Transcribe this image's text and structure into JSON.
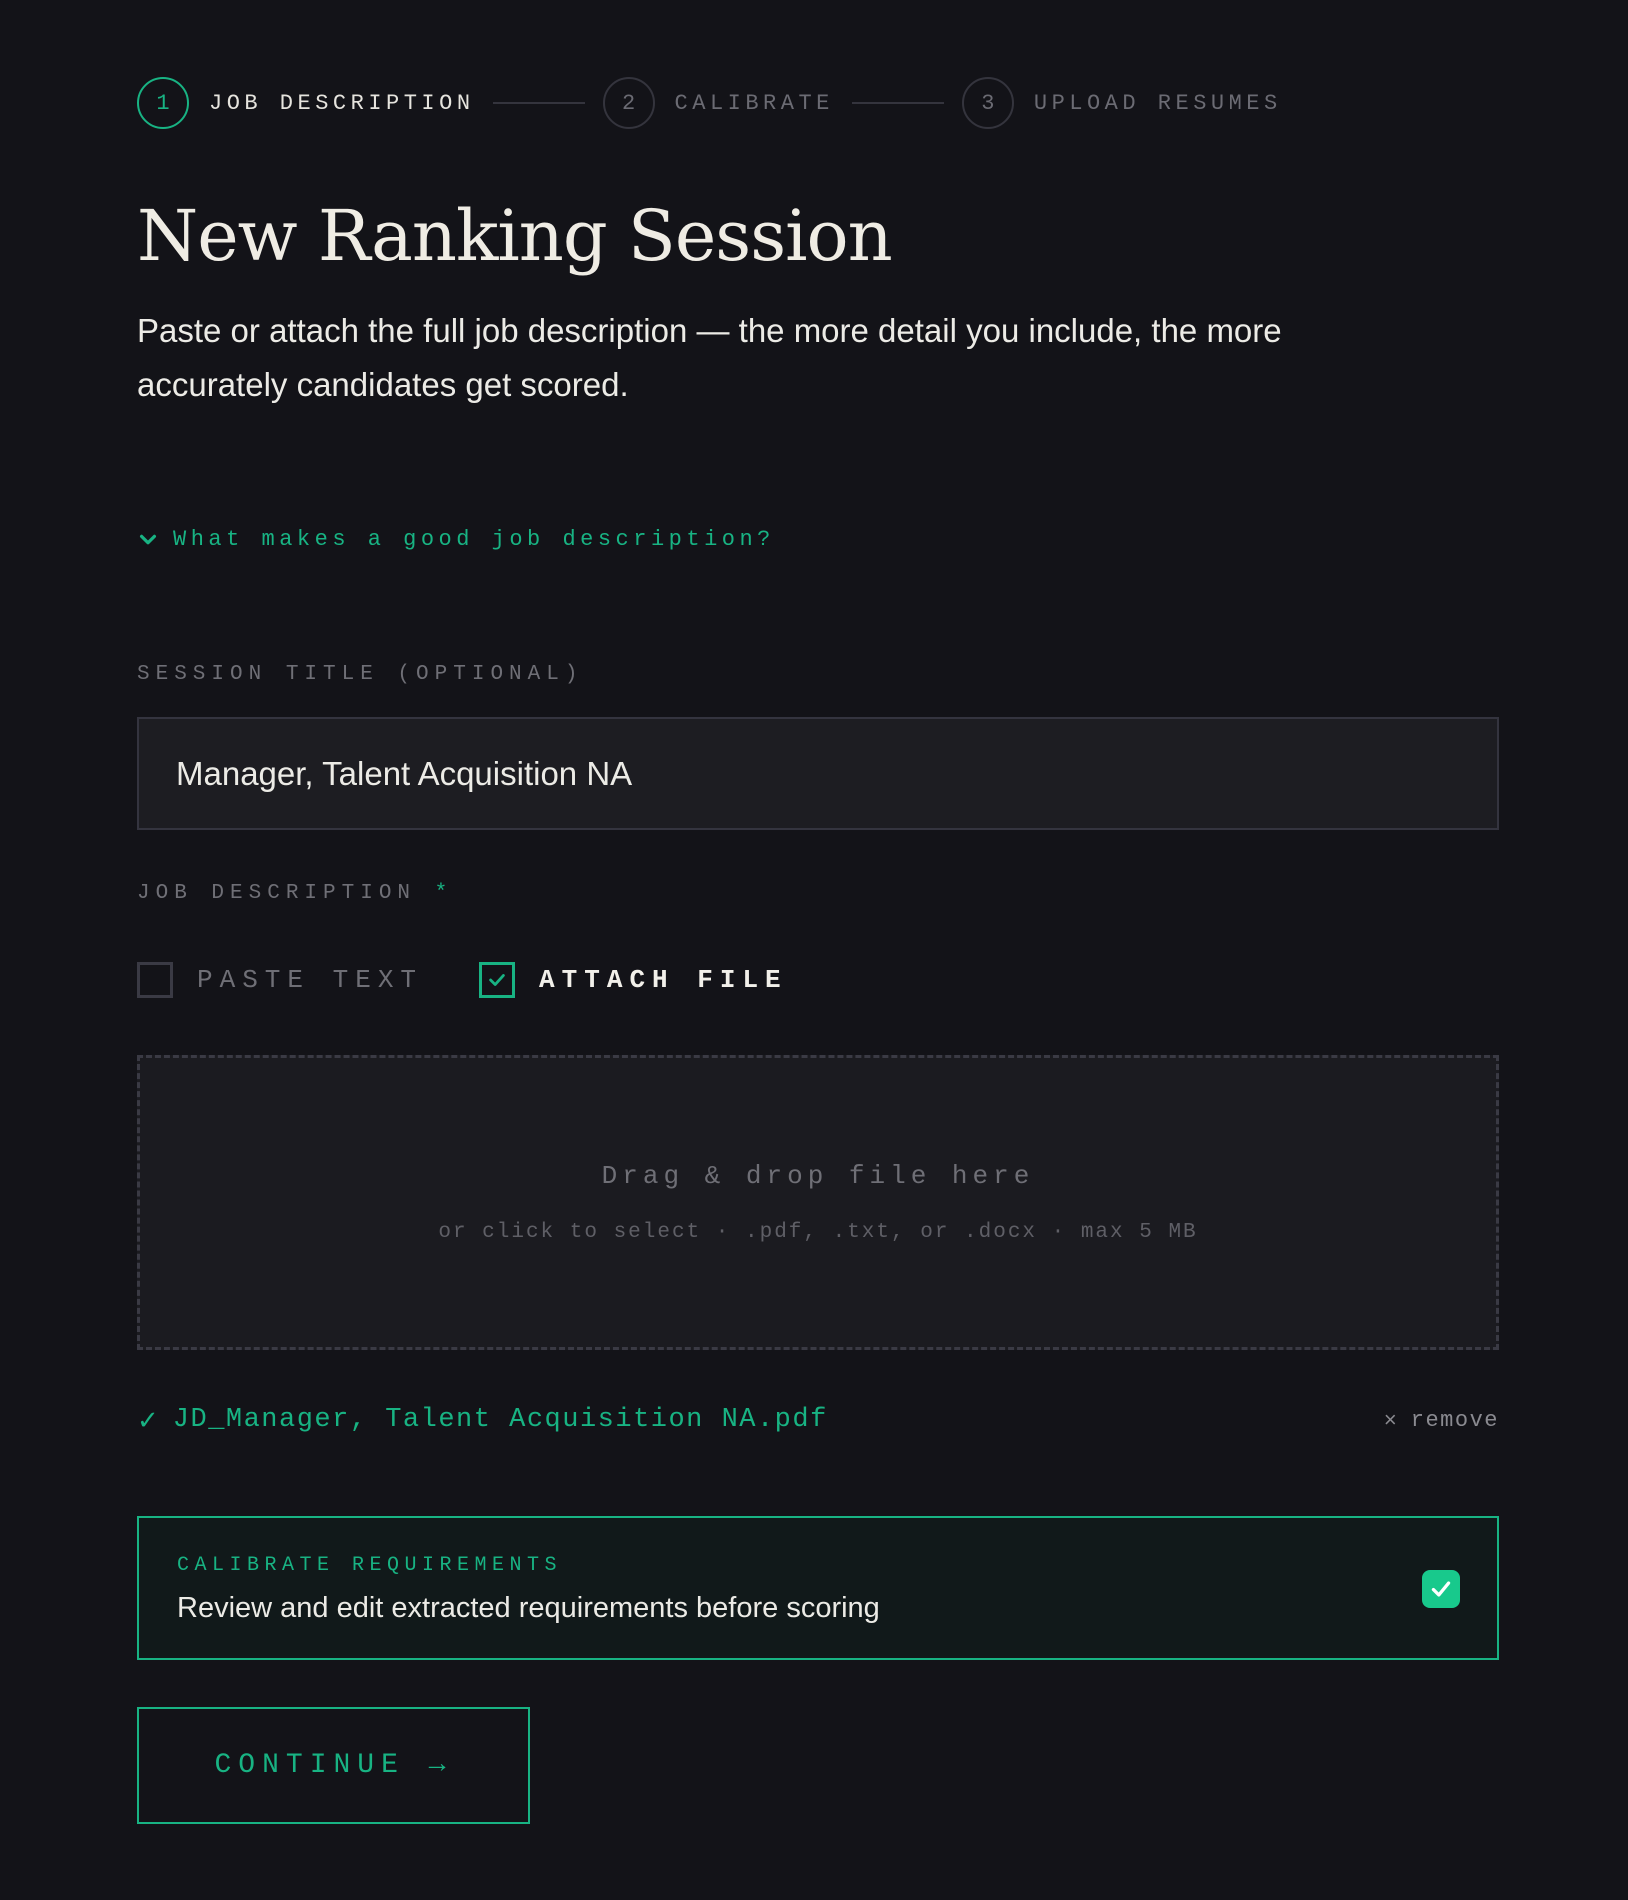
{
  "stepper": {
    "steps": [
      {
        "number": "1",
        "label": "JOB DESCRIPTION"
      },
      {
        "number": "2",
        "label": "CALIBRATE"
      },
      {
        "number": "3",
        "label": "UPLOAD RESUMES"
      }
    ],
    "active_step": 1
  },
  "header": {
    "title": "New Ranking Session",
    "subtitle": "Paste or attach the full job description — the more detail you include, the more accurately candidates get scored."
  },
  "help": {
    "label": "What makes a good job description?",
    "icon": "chevron-down-icon"
  },
  "session_title": {
    "label": "SESSION TITLE (OPTIONAL)",
    "value": "Manager, Talent Acquisition NA"
  },
  "job_description": {
    "label": "JOB DESCRIPTION",
    "required_marker": "*",
    "modes": [
      {
        "label": "PASTE TEXT",
        "checked": false
      },
      {
        "label": "ATTACH FILE",
        "checked": true
      }
    ]
  },
  "dropzone": {
    "title": "Drag & drop file here",
    "hint": "or click to select · .pdf, .txt, or .docx · max 5 MB"
  },
  "attached_file": {
    "check_glyph": "✓",
    "name": "JD_Manager, Talent Acquisition NA.pdf",
    "remove_glyph": "×",
    "remove_label": "remove"
  },
  "calibrate": {
    "kicker": "CALIBRATE REQUIREMENTS",
    "description": "Review and edit extracted requirements before scoring",
    "enabled": true
  },
  "actions": {
    "continue_label": "CONTINUE →"
  },
  "colors": {
    "accent": "#18b383",
    "background": "#131318",
    "surface": "#1d1d22",
    "muted_text": "#6f6f76"
  }
}
